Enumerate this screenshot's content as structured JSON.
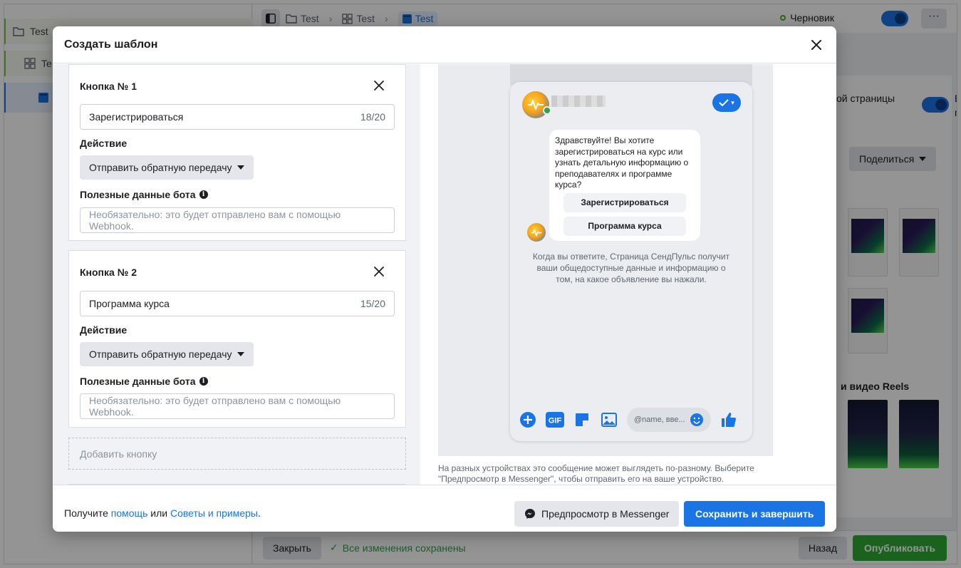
{
  "background": {
    "nav": {
      "item1": "Test",
      "item2": "Te"
    },
    "breadcrumb": [
      "Test",
      "Test",
      "Test"
    ],
    "status": "Черновик",
    "right_panel": {
      "page_text": "ой страницы",
      "share": "Поделиться",
      "reels": "и видео Reels",
      "side_letter_1": "В",
      "side_letter_2": "п"
    },
    "bottom": {
      "close": "Закрыть",
      "saved": "Все изменения сохранены",
      "back": "Назад",
      "publish": "Опубликовать"
    }
  },
  "modal": {
    "title": "Создать шаблон",
    "buttons": [
      {
        "title": "Кнопка № 1",
        "text": "Зарегистрироваться",
        "counter": "18/20",
        "action_label": "Действие",
        "action_value": "Отправить обратную передачу",
        "payload_label": "Полезные данные бота",
        "payload_placeholder": "Необязательно: это будет отправлено вам с помощью Webhook."
      },
      {
        "title": "Кнопка № 2",
        "text": "Программа курса",
        "counter": "15/20",
        "action_label": "Действие",
        "action_value": "Отправить обратную передачу",
        "payload_label": "Полезные данные бота",
        "payload_placeholder": "Необязательно: это будет отправлено вам с помощью Webhook."
      }
    ],
    "add_button": "Добавить кнопку",
    "preview": {
      "message": "Здравствуйте! Вы хотите зарегистрироваться на курс или узнать детальную информацию о преподавателях и программе курса?",
      "quick_replies": [
        "Зарегистрироваться",
        "Программа курса"
      ],
      "disclaimer": "Когда вы ответите, Страница СендПульс получит ваши общедоступные данные и информацию о том, на какое объявление вы нажали.",
      "composer_placeholder": "@name, вве...",
      "gif_label": "GIF",
      "note": "На разных устройствах это сообщение может выглядеть по-разному. Выберите \"Предпросмотр в Messenger\", чтобы отправить его на ваше устройство."
    },
    "footer": {
      "prefix": "Получите ",
      "help_link": "помощь",
      "middle": " или ",
      "tips_link": "Советы и примеры",
      "suffix": ".",
      "messenger_preview": "Предпросмотр в Messenger",
      "save": "Сохранить и завершить"
    }
  },
  "colors": {
    "accent": "#1b74e4",
    "publish": "#2ea934",
    "online": "#31a24c"
  }
}
